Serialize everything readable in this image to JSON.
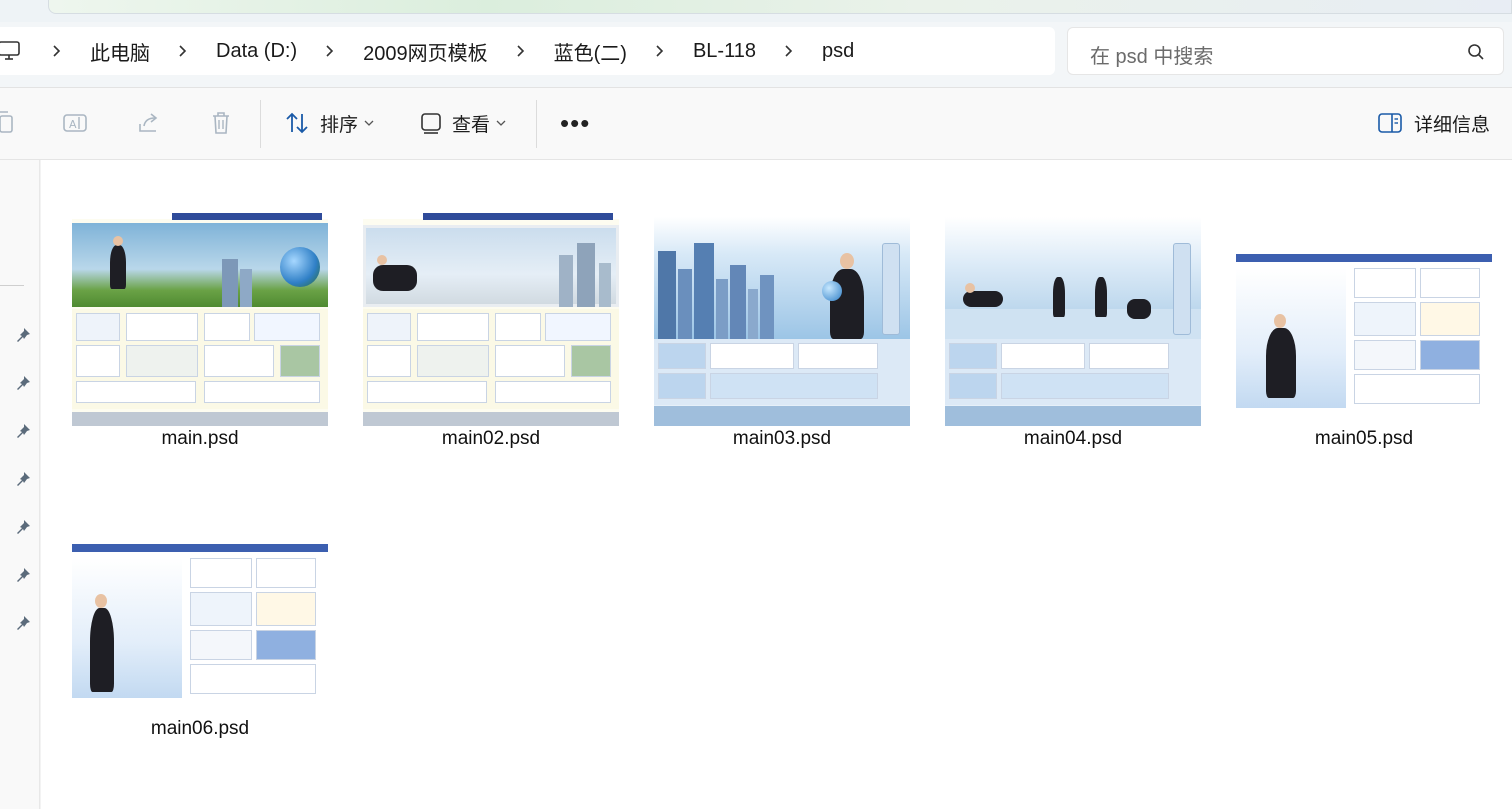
{
  "address": {
    "breadcrumbs": [
      {
        "label": "此电脑"
      },
      {
        "label": "Data (D:)"
      },
      {
        "label": "2009网页模板"
      },
      {
        "label": "蓝色(二)"
      },
      {
        "label": "BL-118"
      },
      {
        "label": "psd"
      }
    ]
  },
  "search": {
    "placeholder": "在 psd 中搜索"
  },
  "toolbar": {
    "sort_label": "排序",
    "view_label": "查看",
    "more_label": "•••",
    "details_label": "详细信息"
  },
  "files": [
    {
      "name": "main.psd"
    },
    {
      "name": "main02.psd"
    },
    {
      "name": "main03.psd"
    },
    {
      "name": "main04.psd"
    },
    {
      "name": "main05.psd"
    },
    {
      "name": "main06.psd"
    }
  ],
  "icons": {
    "pc": "computer-icon",
    "chevron": "chevron-right-icon",
    "search": "search-icon",
    "copy": "copy-icon",
    "rename": "rename-icon",
    "share": "share-icon",
    "delete": "delete-icon",
    "sort": "sort-icon",
    "view": "view-icon",
    "details": "details-pane-icon",
    "pin": "pin-icon"
  },
  "colors": {
    "accent": "#0067c0",
    "thumb_blue": "#2f4b9a"
  }
}
